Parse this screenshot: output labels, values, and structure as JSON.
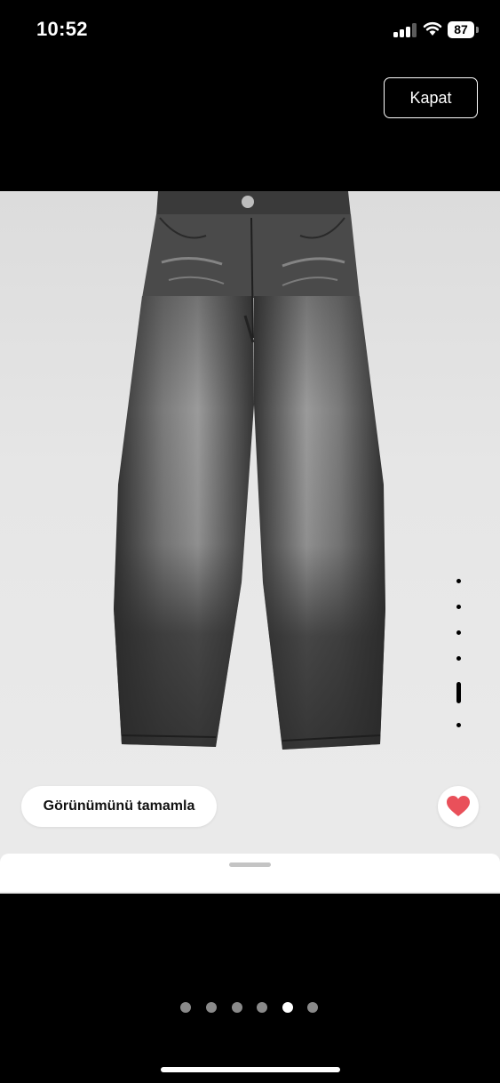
{
  "status_bar": {
    "time": "10:52",
    "battery": "87"
  },
  "header": {
    "close_label": "Kapat"
  },
  "product": {
    "outfit_button_label": "Görünümünü tamamla",
    "image_index_total": 6,
    "image_index_active": 5
  },
  "colors": {
    "favorite": "#e9505a",
    "background": "#000000"
  },
  "icons": [
    "signal-icon",
    "wifi-icon",
    "battery-icon",
    "heart-icon"
  ]
}
